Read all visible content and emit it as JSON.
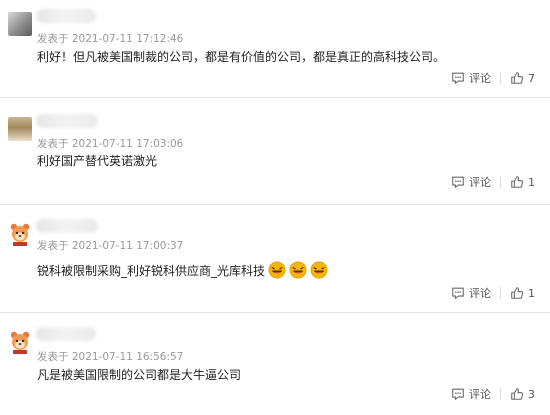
{
  "comments": [
    {
      "meta": "发表于 2021-07-11 17:12:46",
      "text": "利好！但凡被美国制裁的公司，都是有价值的公司，都是真正的高科技公司。",
      "comment_label": "评论",
      "likes": "7",
      "avatar_icon": "photo-avatar-icon"
    },
    {
      "meta": "发表于 2021-07-11 17:03:06",
      "text": "利好国产替代英诺激光",
      "comment_label": "评论",
      "likes": "1",
      "avatar_icon": "photo-avatar-icon"
    },
    {
      "meta": "发表于 2021-07-11 17:00:37",
      "text": "锐科被限制采购_利好锐科供应商_光库科技",
      "comment_label": "评论",
      "likes": "1",
      "avatar_icon": "cartoon-avatar-icon",
      "emojis": [
        "laughing-emoji",
        "laughing-emoji",
        "laughing-emoji"
      ]
    },
    {
      "meta": "发表于 2021-07-11 16:56:57",
      "text": "凡是被美国限制的公司都是大牛逼公司",
      "comment_label": "评论",
      "likes": "3",
      "avatar_icon": "cartoon-avatar-icon"
    }
  ],
  "colors": {
    "meta": "#999999",
    "text": "#222222",
    "divider": "#e5e5e5",
    "emoji": "#f5b800"
  }
}
